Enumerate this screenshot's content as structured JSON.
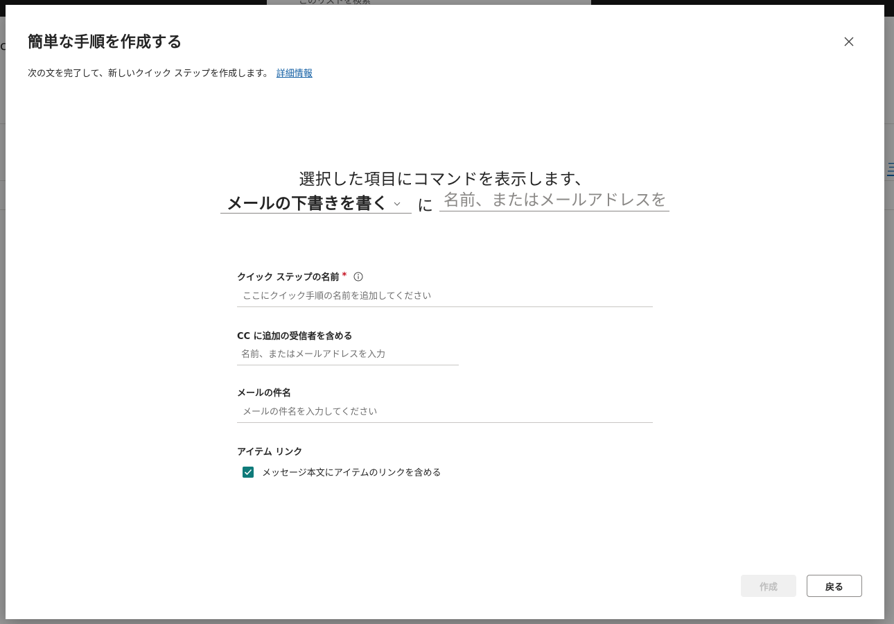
{
  "background": {
    "search_placeholder": "このリストを検索",
    "search_icon": "search-icon",
    "left_glyph": "c",
    "right_glyph": "三"
  },
  "dialog": {
    "title": "簡単な手順を作成する",
    "close_icon": "close-icon",
    "subtitle": "次の文を完了して、新しいクイック ステップを作成します。",
    "learn_more": "詳細情報"
  },
  "sentence": {
    "line1": "選択した項目にコマンドを表示します、",
    "action_value": "メールの下書きを書く",
    "action_icon": "chevron-down-icon",
    "conjunction": "に",
    "to_placeholder": "名前、またはメールアドレスを入力"
  },
  "form": {
    "name_label": "クイック ステップの名前",
    "name_required": "*",
    "name_placeholder": "ここにクイック手順の名前を追加してください",
    "cc_label": "CC に追加の受信者を含める",
    "cc_placeholder": "名前、またはメールアドレスを入力",
    "subject_label": "メールの件名",
    "subject_placeholder": "メールの件名を入力してください",
    "item_link_label": "アイテム リンク",
    "include_link_label": "メッセージ本文にアイテムのリンクを含める",
    "include_link_checked": true
  },
  "footer": {
    "create_label": "作成",
    "back_label": "戻る"
  },
  "colors": {
    "accent_teal": "#0f7b7a",
    "link_blue": "#115ea3",
    "required_red": "#c50f1f"
  }
}
